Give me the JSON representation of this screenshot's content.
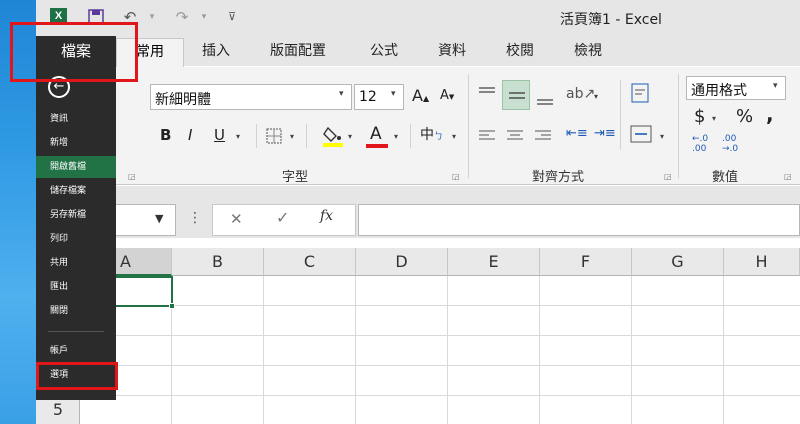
{
  "app": {
    "title": "活頁簿1 - Excel"
  },
  "quick_access": {
    "undo_icon": "undo-icon",
    "redo_icon": "redo-icon"
  },
  "tabs": {
    "file": "檔案",
    "home": "常用",
    "insert": "插入",
    "page_layout": "版面配置",
    "formulas": "公式",
    "data": "資料",
    "review": "校閱",
    "view": "檢視"
  },
  "ribbon": {
    "font_name": "新細明體",
    "font_size": "12",
    "bold": "B",
    "italic": "I",
    "underline": "U",
    "font_group_label": "字型",
    "alignment_group_label": "對齊方式",
    "number_format": "通用格式",
    "currency": "$",
    "percent": "%",
    "comma": ",",
    "dec_increase": ".00",
    "dec_decrease": ".0",
    "number_group_label": "數值",
    "font_color_letter": "A",
    "phonetic_char": "中"
  },
  "formula_bar": {
    "fx": "fx",
    "cancel": "✕",
    "enter": "✓"
  },
  "columns": [
    "A",
    "B",
    "C",
    "D",
    "E",
    "F",
    "G",
    "H"
  ],
  "rows": [
    "5"
  ],
  "file_menu": {
    "items": [
      "資訊",
      "新增",
      "開啟舊檔",
      "儲存檔案",
      "另存新檔",
      "列印",
      "共用",
      "匯出",
      "關閉",
      "帳戶",
      "選項"
    ],
    "active": "開啟舊檔"
  },
  "colors": {
    "brand": "#217346",
    "highlight": "#e0161b"
  }
}
